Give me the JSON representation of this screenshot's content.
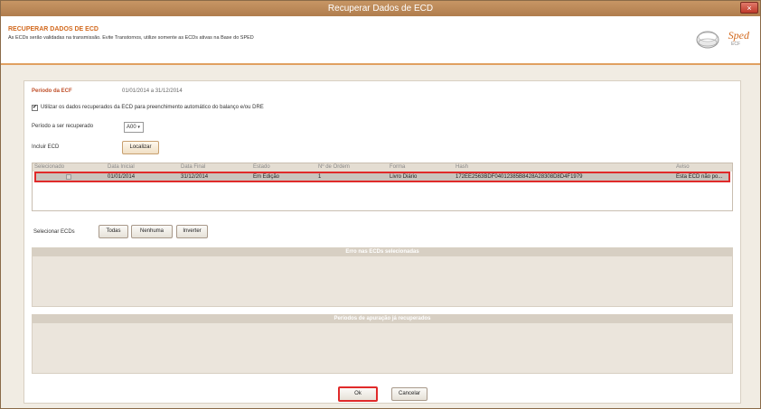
{
  "window": {
    "title": "Recuperar Dados de ECD",
    "close_label": "×"
  },
  "header": {
    "title": "RECUPERAR DADOS DE ECD",
    "subtitle": "As ECDs serão validadas na transmissão. Evite Transtornos, utilize somente as ECDs ativas na Base do SPED",
    "logo_text": "Sped",
    "logo_sub": "ECF"
  },
  "form": {
    "periodo_ecf_label": "Período da ECF",
    "periodo_ecf_value": "01/01/2014 a 31/12/2014",
    "utilizar_checkbox_label": "Utilizar os dados recuperados da ECD para preenchimento automático do balanço e/ou DRE",
    "utilizar_checked": true,
    "periodo_recuperado_label": "Período a ser recuperado",
    "periodo_recuperado_value": "A00",
    "incluir_ecd_label": "Incluir ECD",
    "localizar_label": "Localizar"
  },
  "table": {
    "columns": [
      "Selecionado",
      "Data Inicial",
      "Data Final",
      "Estado",
      "Nº de Ordem",
      "Forma",
      "Hash",
      "Aviso"
    ],
    "rows": [
      {
        "selecionado": false,
        "data_inicial": "01/01/2014",
        "data_final": "31/12/2014",
        "estado": "Em Edição",
        "ordem": "1",
        "forma": "Livro Diário",
        "hash": "172EE2563BDF04012385B8428A28308D8D4F1979",
        "aviso": "Esta ECD não po..."
      }
    ]
  },
  "selection": {
    "label": "Selecionar ECDs",
    "todas": "Todas",
    "nenhuma": "Nenhuma",
    "inverter": "Inverter"
  },
  "sections": {
    "erro_title": "Erro nas ECDs selecionadas",
    "periodos_title": "Períodos de apuração já recuperados"
  },
  "footer": {
    "ok_label": "Ok",
    "cancelar_label": "Cancelar"
  },
  "colors": {
    "accent": "#d2691e",
    "highlight": "#e02a2a",
    "titlebar": "#b07d4d"
  }
}
